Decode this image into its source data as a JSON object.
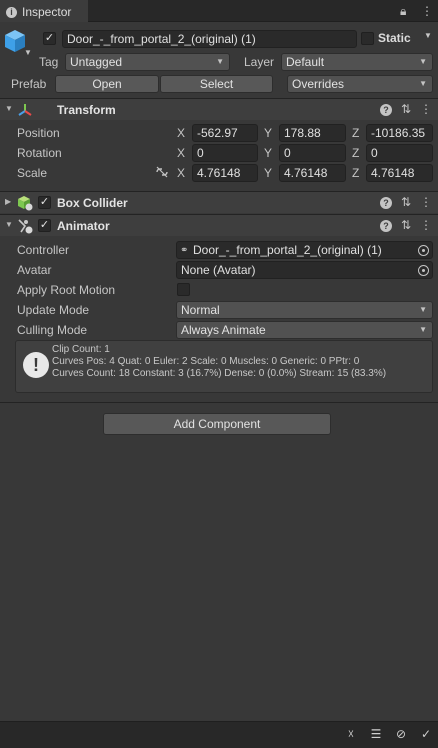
{
  "tab": {
    "title": "Inspector"
  },
  "header": {
    "object_name": "Door_-_from_portal_2_(original) (1)",
    "active_checked": "✓",
    "static_label": "Static",
    "tag_label": "Tag",
    "tag_value": "Untagged",
    "layer_label": "Layer",
    "layer_value": "Default",
    "prefab_label": "Prefab",
    "open_label": "Open",
    "select_label": "Select",
    "overrides_label": "Overrides"
  },
  "transform": {
    "title": "Transform",
    "rows": [
      {
        "label": "Position",
        "x": "-562.97",
        "y": "178.88",
        "z": "-10186.35"
      },
      {
        "label": "Rotation",
        "x": "0",
        "y": "0",
        "z": "0"
      },
      {
        "label": "Scale",
        "x": "4.76148",
        "y": "4.76148",
        "z": "4.76148"
      }
    ],
    "axes": {
      "x": "X",
      "y": "Y",
      "z": "Z"
    }
  },
  "box_collider": {
    "title": "Box Collider",
    "checked": "✓"
  },
  "animator": {
    "title": "Animator",
    "checked": "✓",
    "controller_label": "Controller",
    "controller_value": "Door_-_from_portal_2_(original) (1)",
    "avatar_label": "Avatar",
    "avatar_value": "None (Avatar)",
    "apply_root_label": "Apply Root Motion",
    "update_label": "Update Mode",
    "update_value": "Normal",
    "culling_label": "Culling Mode",
    "culling_value": "Always Animate",
    "info": {
      "line1": "Clip Count: 1",
      "line2": "Curves Pos: 4 Quat: 0 Euler: 2 Scale: 0 Muscles: 0 Generic: 0 PPtr: 0",
      "line3": "Curves Count: 18 Constant: 3 (16.7%) Dense: 0 (0.0%) Stream: 15 (83.3%)"
    }
  },
  "add_component_label": "Add Component",
  "colors": {
    "background": "#383838",
    "field": "#2a2a2a",
    "header": "#3e3e3e",
    "accent_cube": "#3ea0e8"
  }
}
